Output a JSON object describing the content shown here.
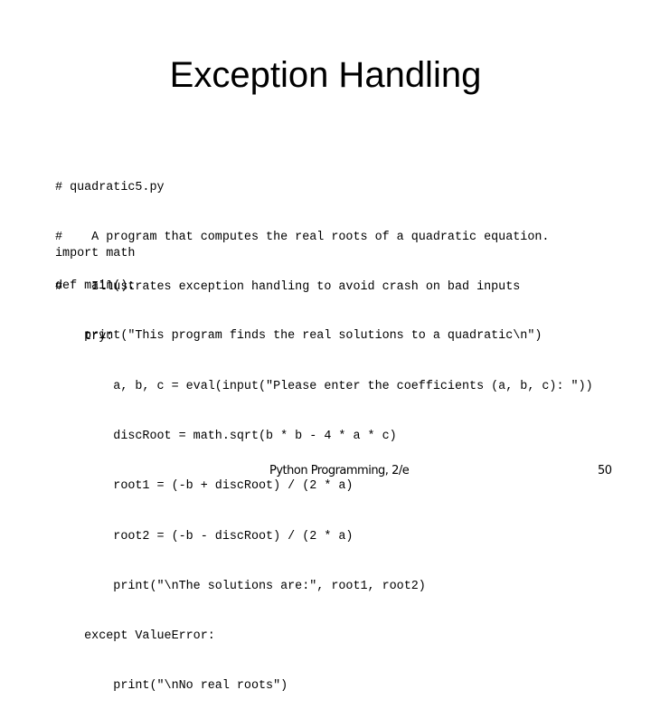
{
  "slide": {
    "title": "Exception Handling",
    "code": {
      "header_comments": [
        "# quadratic5.py",
        "#    A program that computes the real roots of a quadratic equation.",
        "#    Illustrates exception handling to avoid crash on bad inputs"
      ],
      "imports": [
        "import math"
      ],
      "definition": [
        "def main():",
        "    print(\"This program finds the real solutions to a quadratic\\n\")"
      ],
      "try_block": [
        "    try:",
        "        a, b, c = eval(input(\"Please enter the coefficients (a, b, c): \"))",
        "        discRoot = math.sqrt(b * b - 4 * a * c)",
        "        root1 = (-b + discRoot) / (2 * a)",
        "        root2 = (-b - discRoot) / (2 * a)",
        "        print(\"\\nThe solutions are:\", root1, root2)",
        "    except ValueError:",
        "        print(\"\\nNo real roots\")"
      ]
    },
    "footer": {
      "text": "Python Programming, 2/e",
      "page_number": "50"
    }
  }
}
